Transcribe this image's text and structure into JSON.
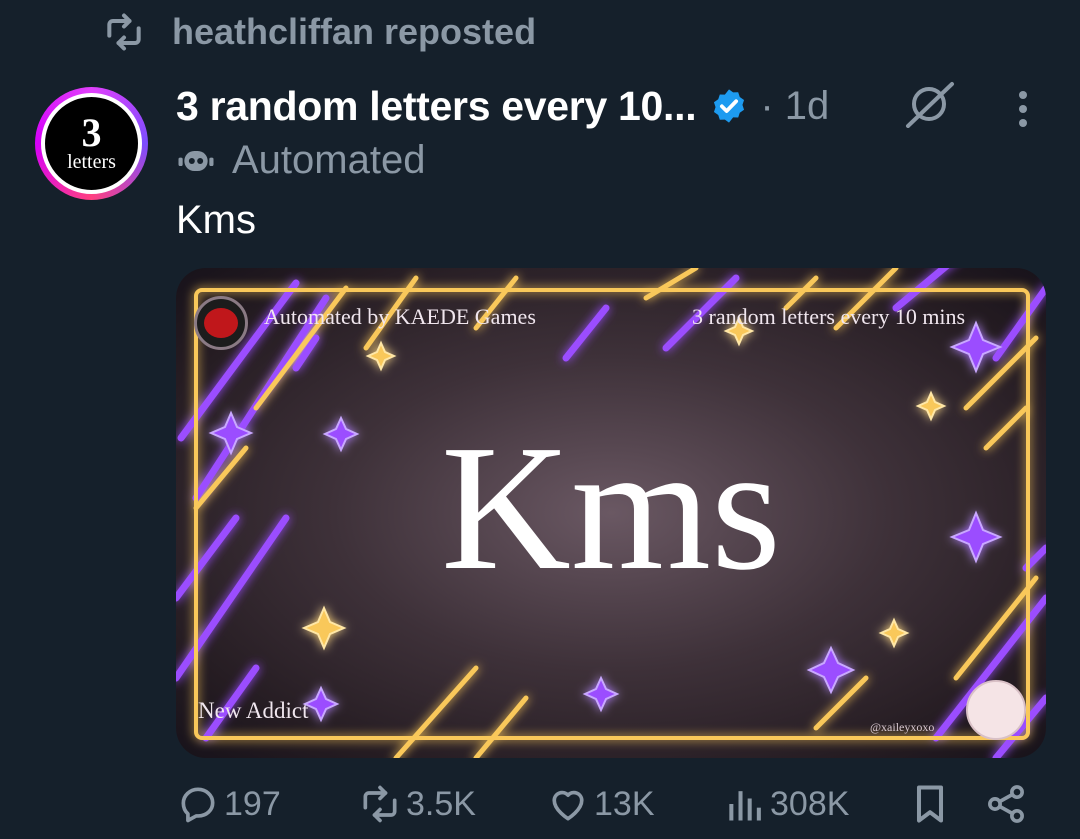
{
  "repost": {
    "text": "heathcliffan reposted",
    "icon": "repost-icon"
  },
  "author": {
    "display_name": "3 random letters every 10...",
    "time": "· 1d",
    "label": "Automated",
    "avatar_number": "3",
    "avatar_word": "letters"
  },
  "post": {
    "text": "Kms"
  },
  "media": {
    "main_text": "Kms",
    "top_left": "Automated by KAEDE Games",
    "top_right": "3 random letters every 10 mins",
    "bottom_left": "New Addict",
    "bottom_right": "@xaileyxoxo"
  },
  "actions": {
    "replies": "197",
    "reposts": "3.5K",
    "likes": "13K",
    "views": "308K"
  },
  "colors": {
    "background": "#15202b",
    "muted": "#8b98a5",
    "verified": "#1d9bf0",
    "neon_gold": "#f9c85a",
    "neon_purple": "#9b4dff"
  }
}
